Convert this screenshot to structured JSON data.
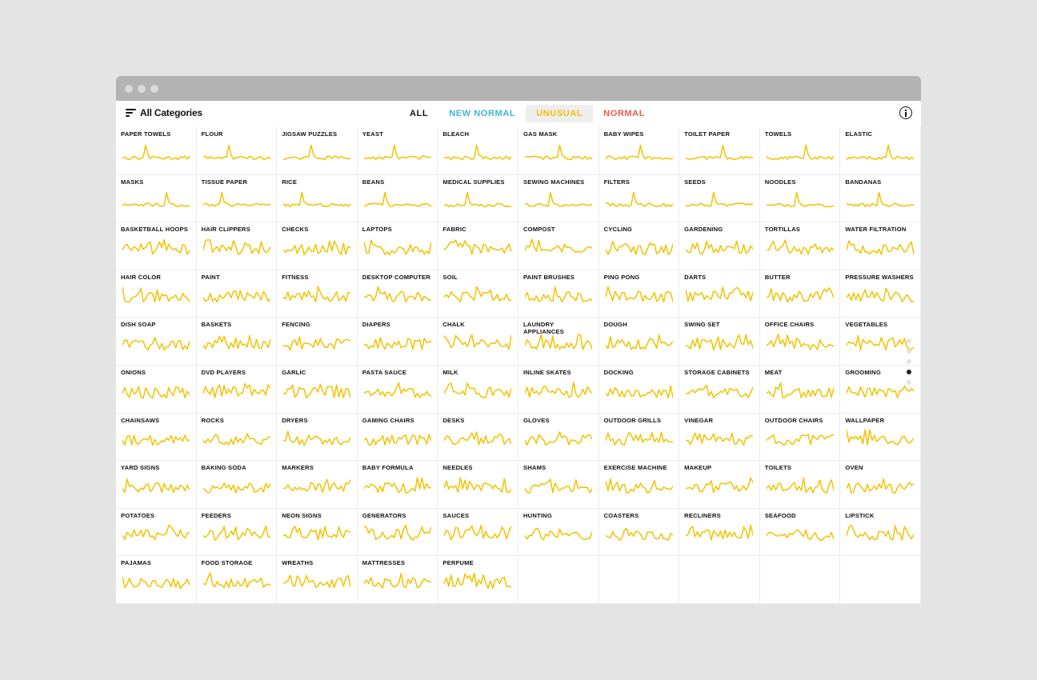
{
  "filter": {
    "label": "All Categories",
    "icon": "filter-icon"
  },
  "tabs": [
    {
      "label": "ALL",
      "color": "#111111"
    },
    {
      "label": "NEW NORMAL",
      "color": "#3fb3d9"
    },
    {
      "label": "UNUSUAL",
      "color": "#f0c000",
      "selected": true
    },
    {
      "label": "NORMAL",
      "color": "#ef5b4a"
    }
  ],
  "info_icon": "info-icon",
  "sparkline_color": "#f2c200",
  "pagination": {
    "count": 5,
    "active": 4
  },
  "categories": [
    "PAPER TOWELS",
    "FLOUR",
    "JIGSAW PUZZLES",
    "YEAST",
    "BLEACH",
    "GAS MASK",
    "BABY WIPES",
    "TOILET PAPER",
    "TOWELS",
    "ELASTIC",
    "MASKS",
    "TISSUE PAPER",
    "RICE",
    "BEANS",
    "MEDICAL SUPPLIES",
    "SEWING MACHINES",
    "FILTERS",
    "SEEDS",
    "NOODLES",
    "BANDANAS",
    "BASKETBALL HOOPS",
    "HAIR CLIPPERS",
    "CHECKS",
    "LAPTOPS",
    "FABRIC",
    "COMPOST",
    "CYCLING",
    "GARDENING",
    "TORTILLAS",
    "WATER FILTRATION",
    "HAIR COLOR",
    "PAINT",
    "FITNESS",
    "DESKTOP COMPUTER",
    "SOIL",
    "PAINT BRUSHES",
    "PING PONG",
    "DARTS",
    "BUTTER",
    "PRESSURE WASHERS",
    "DISH SOAP",
    "BASKETS",
    "FENCING",
    "DIAPERS",
    "CHALK",
    "LAUNDRY APPLIANCES",
    "DOUGH",
    "SWING SET",
    "OFFICE CHAIRS",
    "VEGETABLES",
    "ONIONS",
    "DVD PLAYERS",
    "GARLIC",
    "PASTA SAUCE",
    "MILK",
    "INLINE SKATES",
    "DOCKING",
    "STORAGE CABINETS",
    "MEAT",
    "GROOMING",
    "CHAINSAWS",
    "ROCKS",
    "DRYERS",
    "GAMING CHAIRS",
    "DESKS",
    "GLOVES",
    "OUTDOOR GRILLS",
    "VINEGAR",
    "OUTDOOR CHAIRS",
    "WALLPAPER",
    "YARD SIGNS",
    "BAKING SODA",
    "MARKERS",
    "BABY FORMULA",
    "NEEDLES",
    "SHAMS",
    "EXERCISE MACHINE",
    "MAKEUP",
    "TOILETS",
    "OVEN",
    "POTATOES",
    "FEEDERS",
    "NEON SIGNS",
    "GENERATORS",
    "SAUCES",
    "HUNTING",
    "COASTERS",
    "RECLINERS",
    "SEAFOOD",
    "LIPSTICK",
    "PAJAMAS",
    "FOOD STORAGE",
    "WREATHS",
    "MATTRESSES",
    "PERFUME"
  ]
}
